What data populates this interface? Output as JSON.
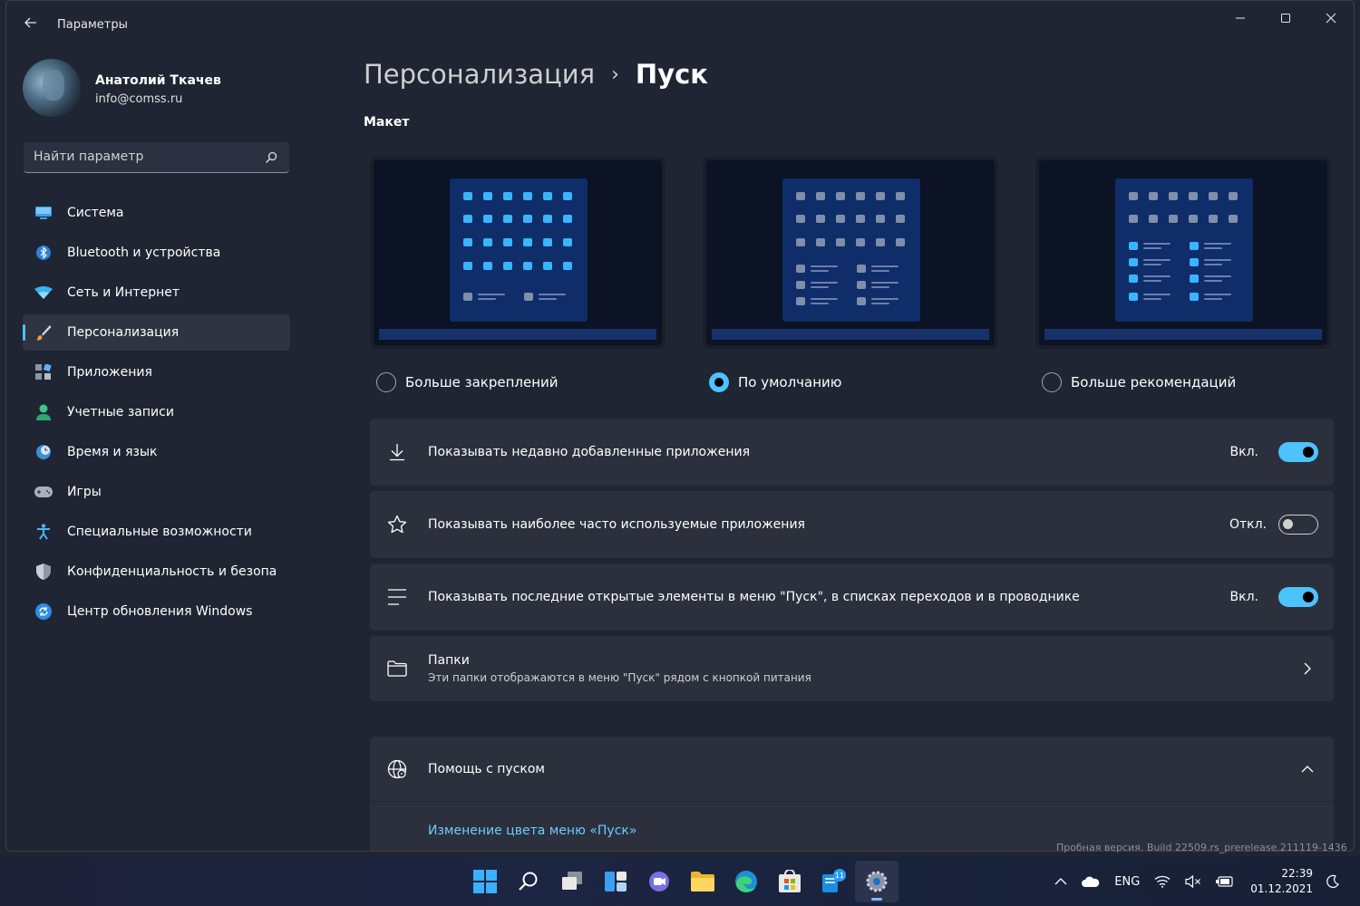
{
  "app": {
    "title": "Параметры"
  },
  "profile": {
    "name": "Анатолий Ткачев",
    "email": "info@comss.ru"
  },
  "search": {
    "placeholder": "Найти параметр"
  },
  "sidebar": {
    "items": [
      {
        "label": "Система",
        "icon": "monitor-icon"
      },
      {
        "label": "Bluetooth и устройства",
        "icon": "bluetooth-icon"
      },
      {
        "label": "Сеть и Интернет",
        "icon": "wifi-icon"
      },
      {
        "label": "Персонализация",
        "icon": "brush-icon",
        "active": true
      },
      {
        "label": "Приложения",
        "icon": "apps-icon"
      },
      {
        "label": "Учетные записи",
        "icon": "person-icon"
      },
      {
        "label": "Время и язык",
        "icon": "globe-clock-icon"
      },
      {
        "label": "Игры",
        "icon": "gamepad-icon"
      },
      {
        "label": "Специальные возможности",
        "icon": "accessibility-icon"
      },
      {
        "label": "Конфиденциальность и безопасность",
        "icon": "shield-icon"
      },
      {
        "label": "Центр обновления Windows",
        "icon": "update-icon"
      }
    ]
  },
  "breadcrumb": {
    "parent": "Персонализация",
    "separator": "›",
    "current": "Пуск"
  },
  "layout_section": {
    "title": "Макет",
    "options": [
      {
        "label": "Больше закреплений",
        "selected": false
      },
      {
        "label": "По умолчанию",
        "selected": true
      },
      {
        "label": "Больше рекомендаций",
        "selected": false
      }
    ]
  },
  "settings": [
    {
      "label": "Показывать недавно добавленные приложения",
      "state": "Вкл.",
      "on": true,
      "icon": "download-icon"
    },
    {
      "label": "Показывать наиболее часто используемые приложения",
      "state": "Откл.",
      "on": false,
      "icon": "star-icon"
    },
    {
      "label": "Показывать последние открытые элементы в меню \"Пуск\", в списках переходов и в проводнике",
      "state": "Вкл.",
      "on": true,
      "icon": "list-icon"
    }
  ],
  "folders": {
    "label": "Папки",
    "sublabel": "Эти папки отображаются в меню \"Пуск\" рядом с кнопкой питания",
    "icon": "folder-icon"
  },
  "help": {
    "label": "Помощь с пуском",
    "link": "Изменение цвета меню «Пуск»",
    "icon": "globe-help-icon"
  },
  "watermark": "Пробная версия. Build 22509.rs_prerelease.211119-1436",
  "taskbar": {
    "apps": [
      "windows-start-icon",
      "search-icon",
      "task-view-icon",
      "widgets-icon",
      "teams-chat-icon",
      "file-explorer-icon",
      "edge-icon",
      "store-icon",
      "insider-icon",
      "settings-icon"
    ],
    "insider_badge": "11",
    "language": "ENG",
    "time": "22:39",
    "date": "01.12.2021"
  },
  "colors": {
    "accent": "#4cc2ff",
    "background": "#202533",
    "card": "#2b303c"
  }
}
